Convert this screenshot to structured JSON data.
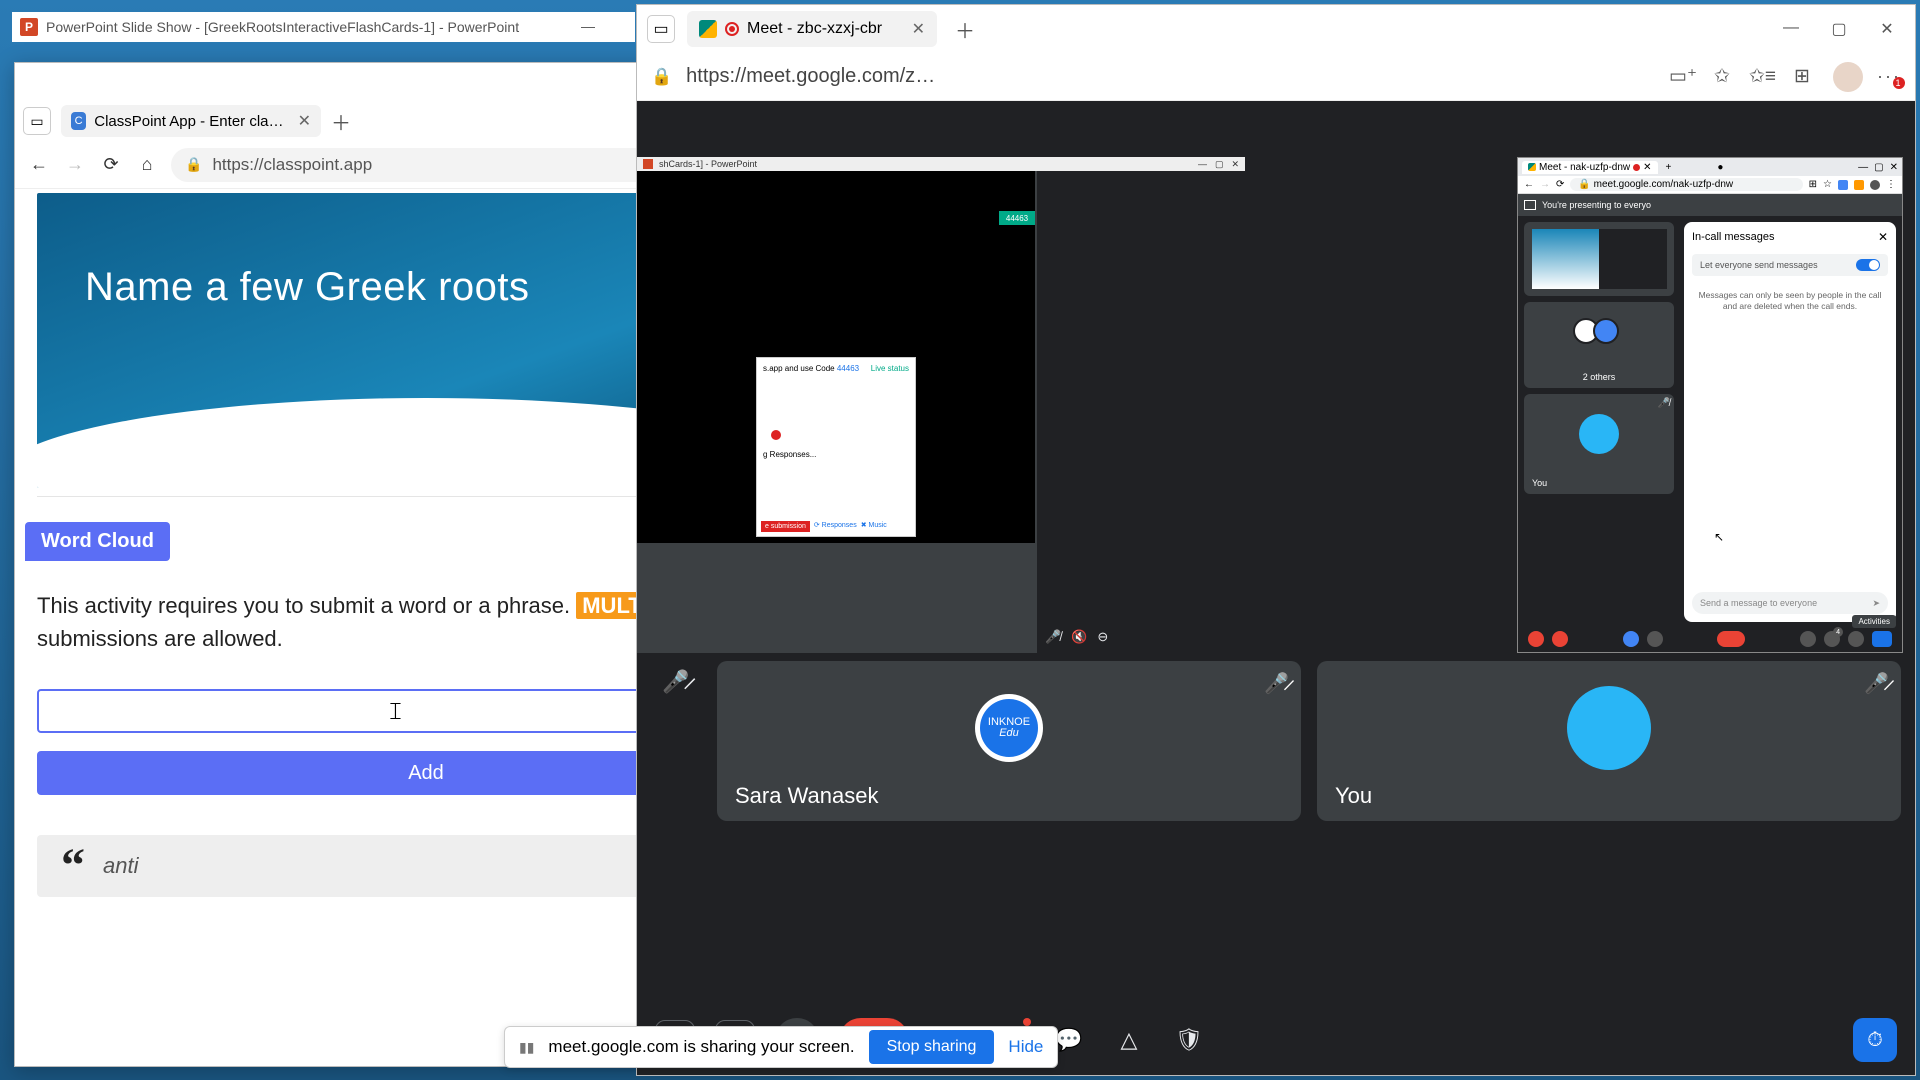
{
  "powerpoint": {
    "title": "PowerPoint Slide Show - [GreekRootsInteractiveFlashCards-1] - PowerPoint",
    "shared_inner_title": "shCards-1] - PowerPoint"
  },
  "left_browser": {
    "tab_label": "ClassPoint App - Enter class code",
    "url": "https://classpoint.app",
    "addr_badge": "1"
  },
  "classpoint": {
    "prompt": "Name a few Greek roots",
    "badge": "Word Cloud",
    "instruction_pre": "This activity requires you to submit a word or a phrase. ",
    "instruction_multi": "MULTIPLE",
    "instruction_post": " submissions are allowed.",
    "input_value": "",
    "add_label": "Add",
    "submitted_word": "anti"
  },
  "share_banner": {
    "text": "meet.google.com is sharing your screen.",
    "stop": "Stop sharing",
    "hide": "Hide"
  },
  "right_browser": {
    "tab_label": "Meet - zbc-xzxj-cbr",
    "url": "https://meet.google.com/zbc-xz..."
  },
  "mini_browser": {
    "tab_label": "Meet - nak-uzfp-dnw",
    "url": "meet.google.com/nak-uzfp-dnw",
    "presenting": "You're presenting to everyo",
    "two_others": "2 others",
    "you": "You",
    "chat_title": "In-call messages",
    "toggle_label": "Let everyone send messages",
    "chat_note": "Messages can only be seen by people in the call and are deleted when the call ends.",
    "send_placeholder": "Send a message to everyone",
    "activities_tooltip": "Activities",
    "people_badge": "4"
  },
  "shared_toolbar": {
    "code_prefix": "s.app and use Code ",
    "code": "44463",
    "live": "Live status",
    "responses_label": "g Responses...",
    "btn_submission": "e submission",
    "btn_responses": "Responses",
    "btn_music": "Music"
  },
  "participants": {
    "sara": "Sara Wanasek",
    "you": "You",
    "inknoe_top": "INKNOE",
    "inknoe_bottom": "Edu"
  }
}
